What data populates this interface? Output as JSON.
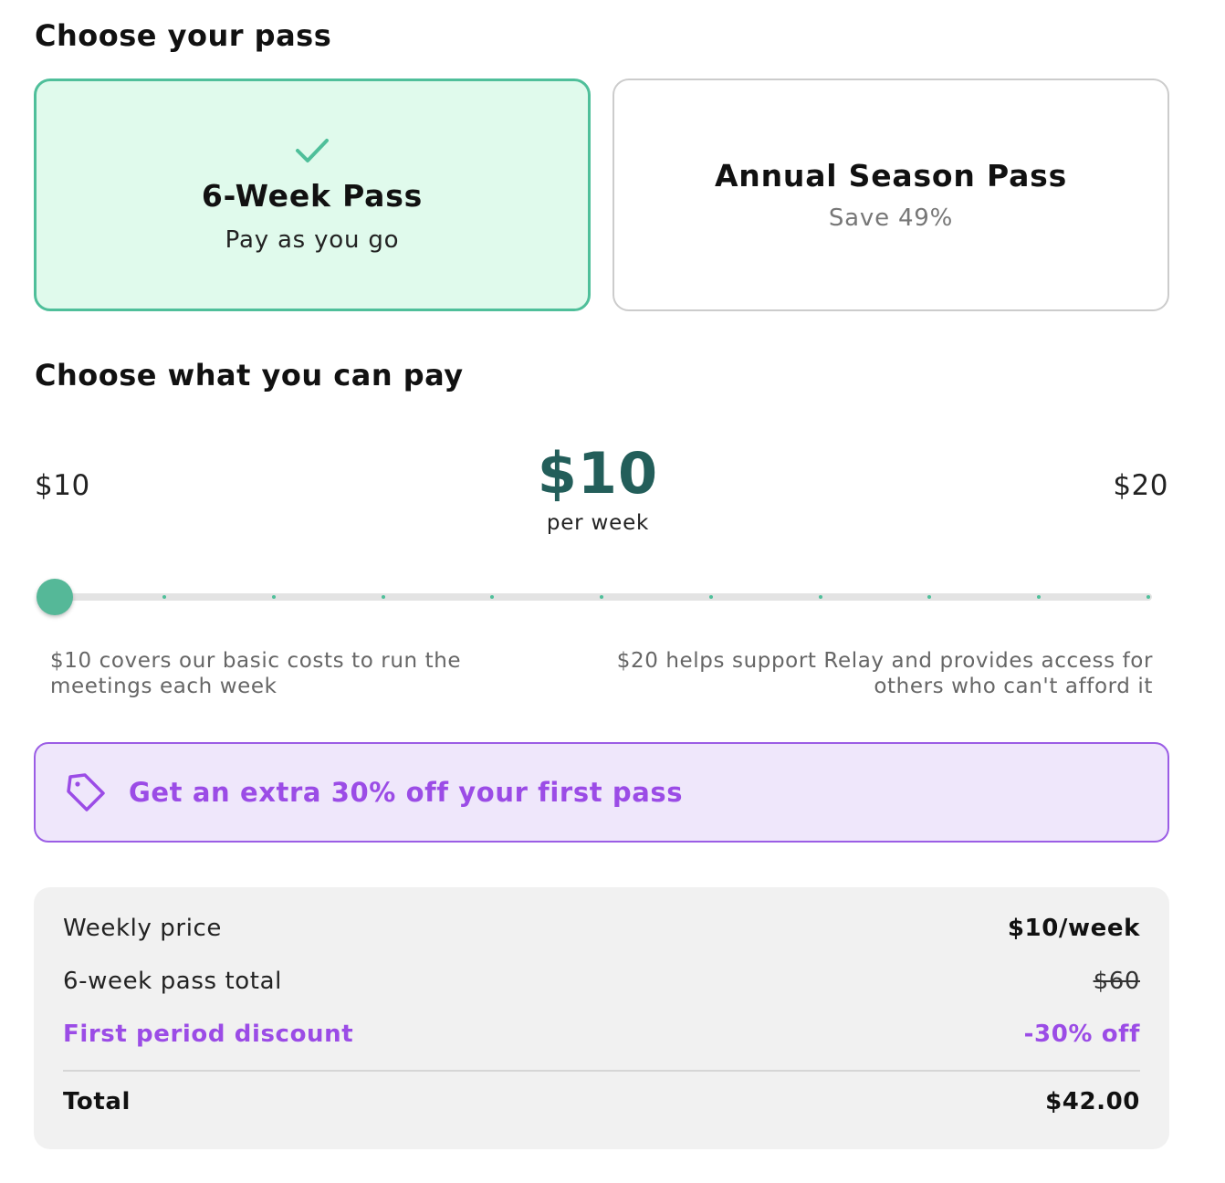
{
  "sections": {
    "pass_heading": "Choose your pass",
    "pay_heading": "Choose what you can pay"
  },
  "passes": [
    {
      "title": "6-Week Pass",
      "subtitle": "Pay as you go",
      "selected": true
    },
    {
      "title": "Annual Season Pass",
      "subtitle": "Save 49%",
      "selected": false
    }
  ],
  "pricing": {
    "min_label": "$10",
    "max_label": "$20",
    "current": "$10",
    "unit": "per week",
    "slider_value": 10,
    "slider_min": 10,
    "slider_max": 20,
    "slider_steps": 10,
    "min_note": "$10 covers our basic costs to run the meetings each week",
    "max_note": "$20 helps support Relay and provides access for others who can't afford it"
  },
  "promo": {
    "icon": "tag-icon",
    "text": "Get an extra 30% off your first pass"
  },
  "summary": {
    "weekly_label": "Weekly price",
    "weekly_value": "$10/week",
    "pass_total_label": "6-week pass total",
    "pass_total_value": "$60",
    "discount_label": "First period discount",
    "discount_value": "-30% off",
    "total_label": "Total",
    "total_value": "$42.00"
  },
  "colors": {
    "accent_green": "#4fbf9a",
    "selected_bg": "#e0faec",
    "price_teal": "#235e5a",
    "promo_purple": "#9b4ce6",
    "promo_bg": "#efe7fb"
  }
}
